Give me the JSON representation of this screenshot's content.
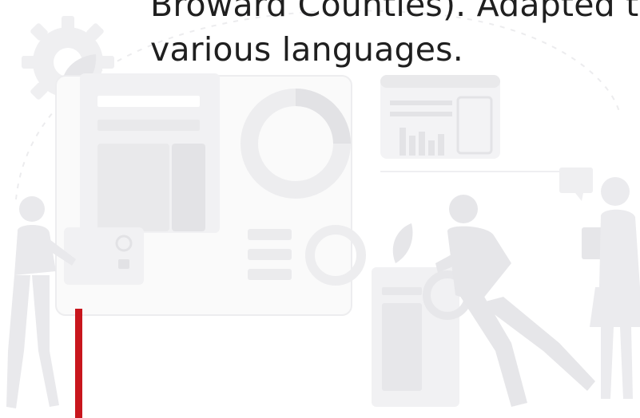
{
  "text": {
    "line1": "Broward Counties). Adapted to",
    "line2": "various languages."
  },
  "illustration": {
    "icons": [
      "gear-icon",
      "leaf-icon",
      "donut-chart-icon",
      "bar-chart-icon",
      "person-icon",
      "plant-icon",
      "clipboard-icon",
      "chat-bubble-icon"
    ]
  },
  "colors": {
    "text": "#1f1f1f",
    "accent": "#c8161d",
    "illustration_light": "#f4f4f5",
    "illustration_mid": "#e8e8ea",
    "illustration_dark": "#dcdcdf"
  }
}
